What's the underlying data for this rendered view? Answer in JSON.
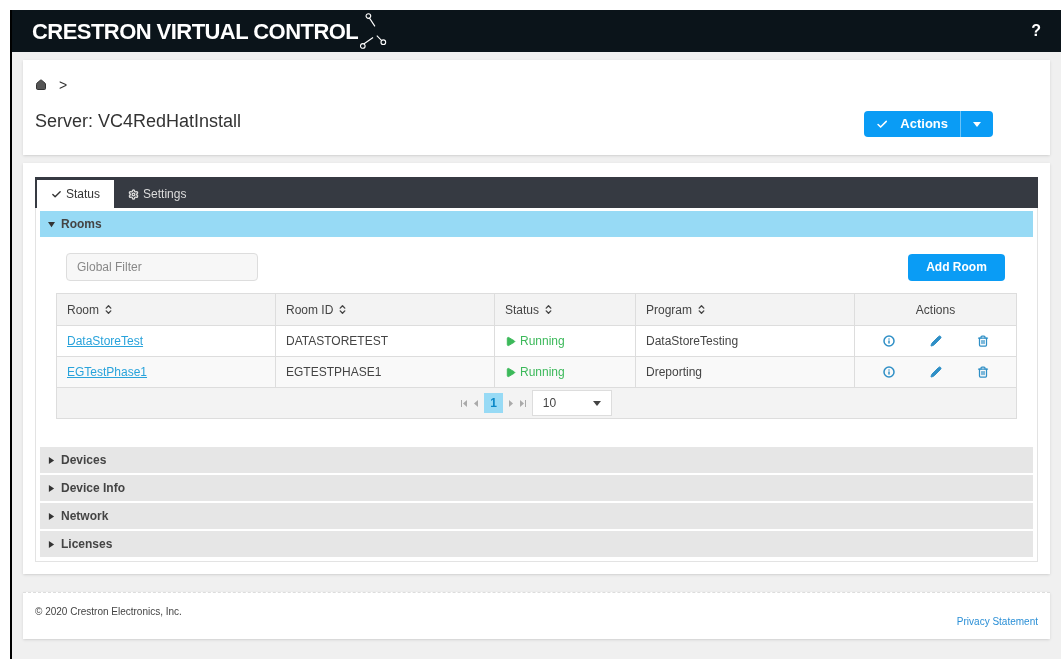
{
  "header": {
    "logo": "CRESTRON VIRTUAL CONTROL",
    "help": "?"
  },
  "breadcrumb": {
    "separator": ">"
  },
  "title": "Server: VC4RedHatInstall",
  "actions_button": {
    "label": "Actions"
  },
  "tabs": [
    {
      "label": "Status",
      "selected": true
    },
    {
      "label": "Settings",
      "selected": false
    }
  ],
  "sections": [
    {
      "title": "Rooms",
      "expanded": true
    },
    {
      "title": "Devices",
      "expanded": false
    },
    {
      "title": "Device Info",
      "expanded": false
    },
    {
      "title": "Network",
      "expanded": false
    },
    {
      "title": "Licenses",
      "expanded": false
    }
  ],
  "rooms": {
    "filter": {
      "placeholder": "Global Filter"
    },
    "add_button": "Add Room",
    "columns": [
      {
        "label": "Room",
        "sortable": true
      },
      {
        "label": "Room ID",
        "sortable": true
      },
      {
        "label": "Status",
        "sortable": true
      },
      {
        "label": "Program",
        "sortable": true
      },
      {
        "label": "Actions",
        "sortable": false
      }
    ],
    "rows": [
      {
        "room": "DataStoreTest",
        "room_id": "DATASTORETEST",
        "status": "Running",
        "running": true,
        "program": "DataStoreTesting"
      },
      {
        "room": "EGTestPhase1",
        "room_id": "EGTESTPHASE1",
        "status": "Running",
        "running": true,
        "program": "Dreporting"
      }
    ],
    "pagination": {
      "pages": [
        {
          "label": "1",
          "selected": true
        }
      ],
      "page_size": "10"
    }
  },
  "footer": {
    "copyright": "© 2020 Crestron Electronics, Inc.",
    "privacy": "Privacy Statement"
  }
}
